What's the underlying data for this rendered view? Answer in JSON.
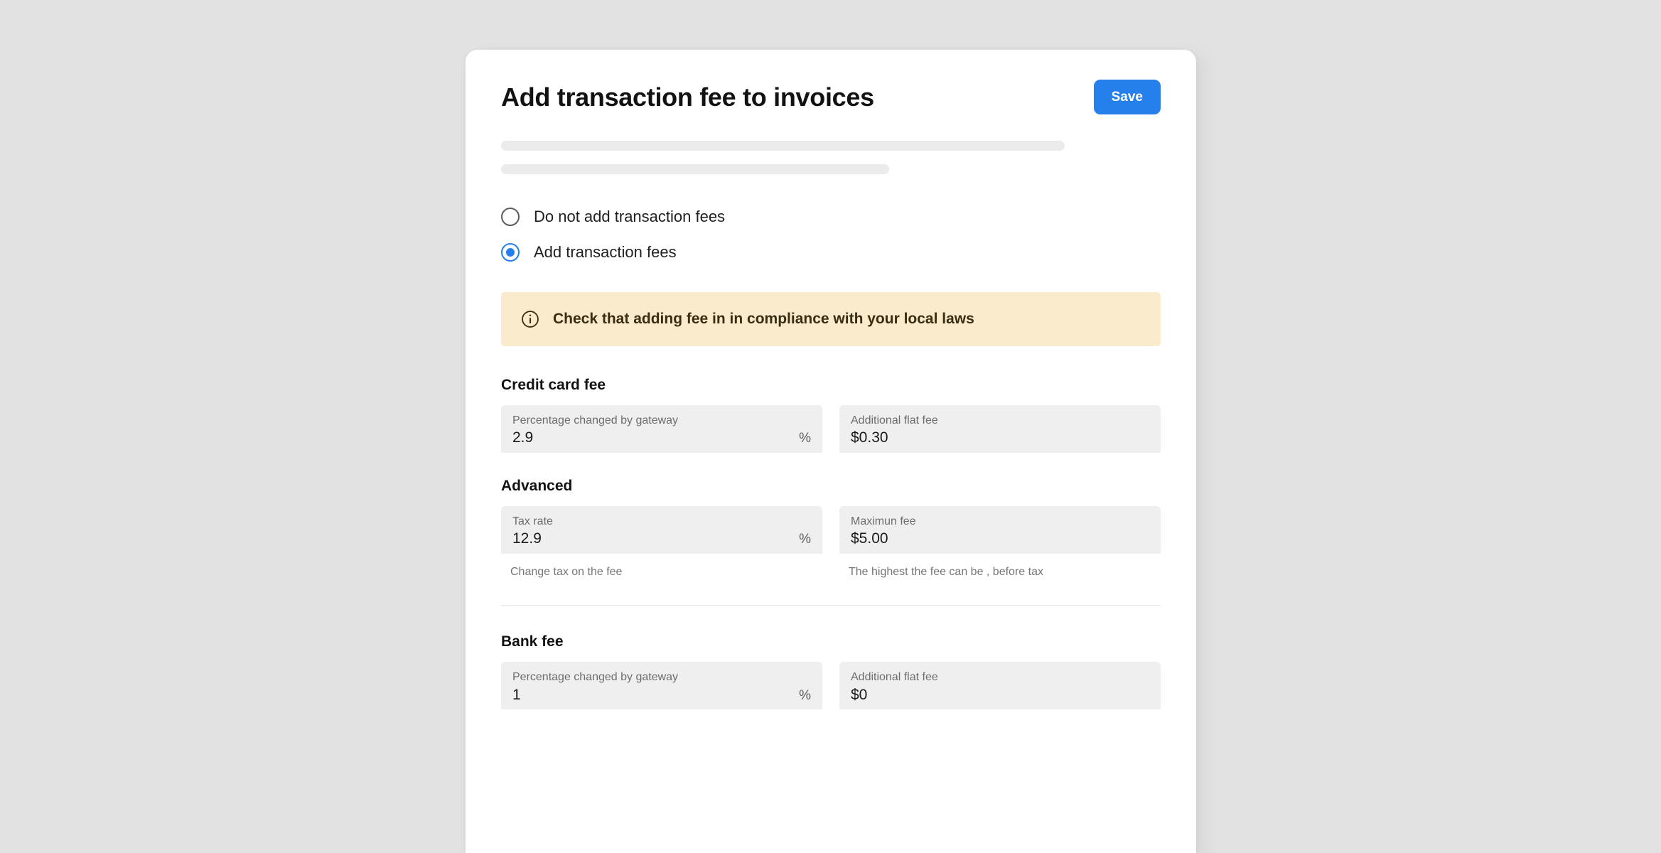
{
  "header": {
    "title": "Add transaction fee to invoices",
    "save_label": "Save"
  },
  "radio_options": [
    {
      "label": "Do not add transaction fees",
      "selected": false
    },
    {
      "label": "Add transaction fees",
      "selected": true
    }
  ],
  "banner": {
    "icon": "info-circle-icon",
    "text": "Check that adding fee in in compliance with your local laws",
    "background_color": "#faebcd",
    "text_color": "#3a2d11"
  },
  "sections": {
    "credit_card": {
      "title": "Credit card fee",
      "percentage": {
        "label": "Percentage changed by gateway",
        "value": "2.9",
        "suffix": "%"
      },
      "flat_fee": {
        "label": "Additional flat fee",
        "value": "$0.30",
        "suffix": ""
      }
    },
    "advanced": {
      "title": "Advanced",
      "tax_rate": {
        "label": "Tax rate",
        "value": "12.9",
        "suffix": "%",
        "help": "Change tax on the fee"
      },
      "maximum_fee": {
        "label": "Maximun fee",
        "value": "$5.00",
        "suffix": "",
        "help": "The highest the fee can be , before tax"
      }
    },
    "bank": {
      "title": "Bank fee",
      "percentage": {
        "label": "Percentage changed by gateway",
        "value": "1",
        "suffix": "%"
      },
      "flat_fee": {
        "label": "Additional flat fee",
        "value": "$0",
        "suffix": ""
      }
    }
  },
  "colors": {
    "accent": "#2680eb",
    "page_background": "#e2e2e2",
    "card_background": "#ffffff",
    "field_background": "#efefef"
  }
}
